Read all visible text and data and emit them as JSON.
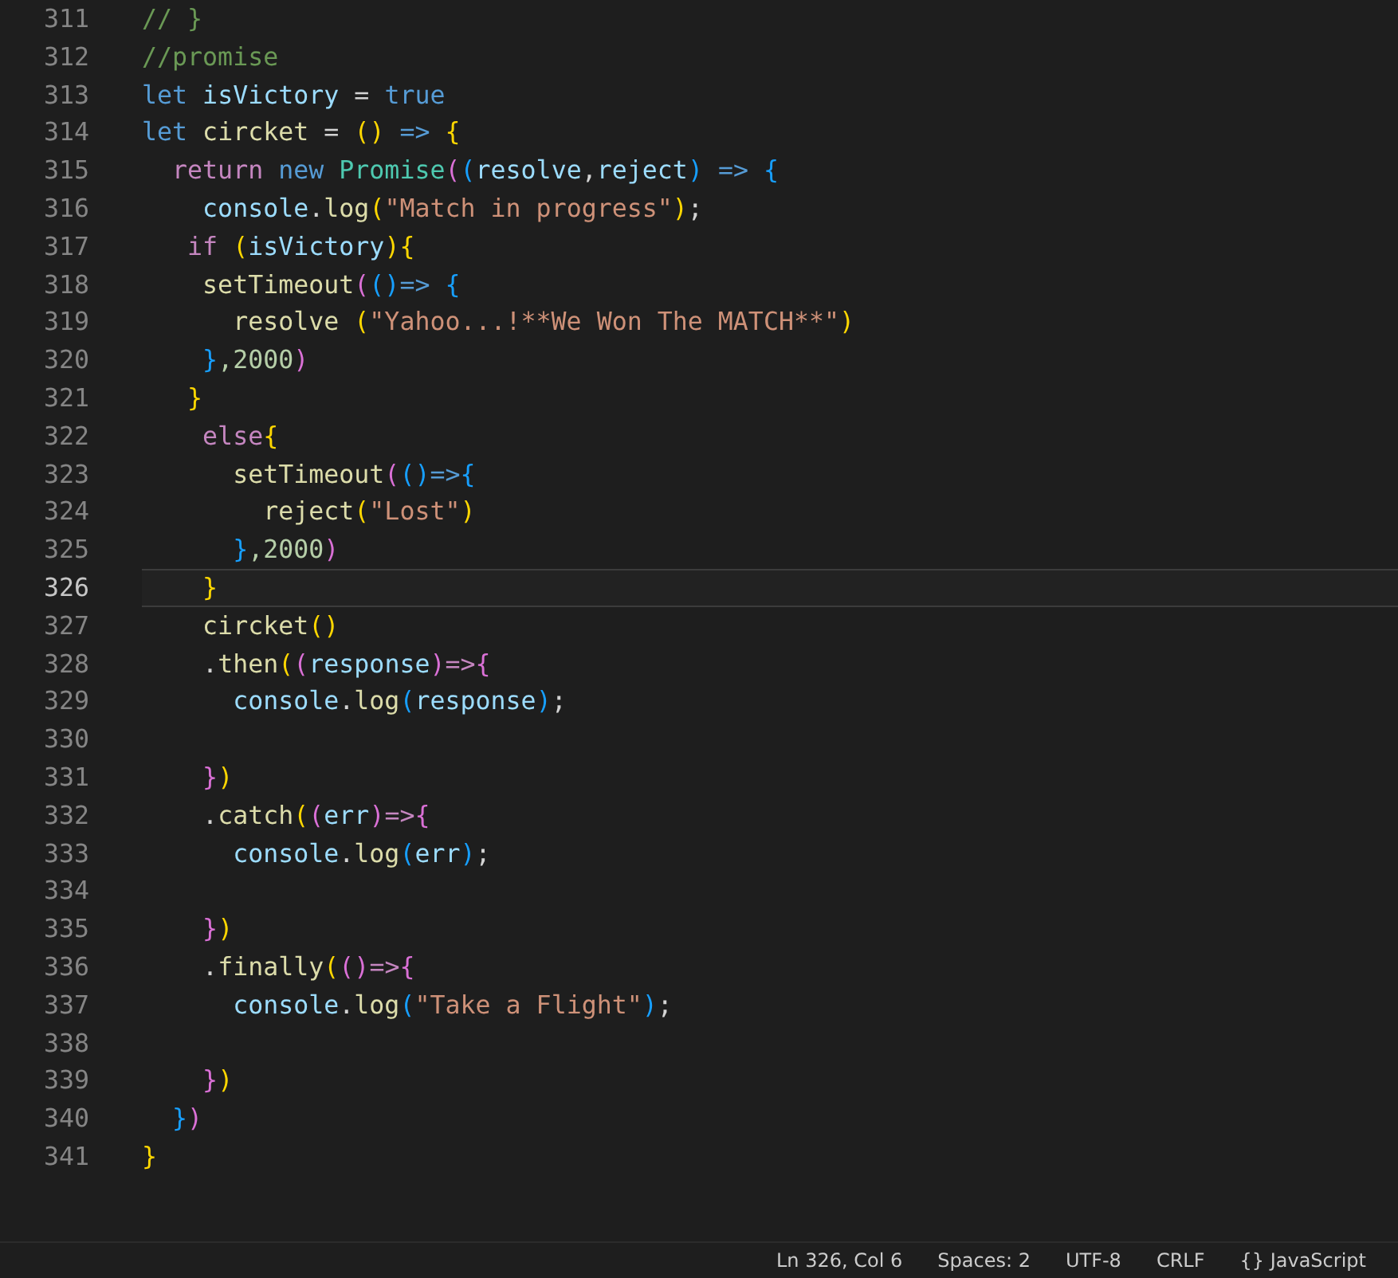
{
  "editor": {
    "lines": [
      {
        "number": "311",
        "current": false,
        "tokens": [
          {
            "kind": "comment",
            "text": "// }"
          }
        ]
      },
      {
        "number": "312",
        "current": false,
        "tokens": [
          {
            "kind": "comment",
            "text": "//promise"
          }
        ]
      },
      {
        "number": "313",
        "current": false,
        "tokens": [
          {
            "kind": "keyword",
            "text": "let"
          },
          {
            "kind": "variable",
            "text": " isVictory"
          },
          {
            "kind": "plain",
            "text": " = "
          },
          {
            "kind": "keyword",
            "text": "true"
          }
        ]
      },
      {
        "number": "314",
        "current": false,
        "tokens": [
          {
            "kind": "keyword",
            "text": "let"
          },
          {
            "kind": "function",
            "text": " circket"
          },
          {
            "kind": "plain",
            "text": " = "
          },
          {
            "kind": "bracket1",
            "text": "()"
          },
          {
            "kind": "keyword",
            "text": " => "
          },
          {
            "kind": "bracket1",
            "text": "{"
          }
        ]
      },
      {
        "number": "315",
        "current": false,
        "tokens": [
          {
            "kind": "control",
            "text": "  return"
          },
          {
            "kind": "keyword",
            "text": " new"
          },
          {
            "kind": "class",
            "text": " Promise"
          },
          {
            "kind": "bracket2",
            "text": "("
          },
          {
            "kind": "bracket3",
            "text": "("
          },
          {
            "kind": "variable",
            "text": "resolve"
          },
          {
            "kind": "plain",
            "text": ","
          },
          {
            "kind": "variable",
            "text": "reject"
          },
          {
            "kind": "bracket3",
            "text": ")"
          },
          {
            "kind": "keyword",
            "text": " => "
          },
          {
            "kind": "bracket3",
            "text": "{"
          }
        ]
      },
      {
        "number": "316",
        "current": false,
        "tokens": [
          {
            "kind": "variable",
            "text": "    console"
          },
          {
            "kind": "plain",
            "text": "."
          },
          {
            "kind": "function",
            "text": "log"
          },
          {
            "kind": "bracket1",
            "text": "("
          },
          {
            "kind": "string",
            "text": "\"Match in progress\""
          },
          {
            "kind": "bracket1",
            "text": ")"
          },
          {
            "kind": "plain",
            "text": ";"
          }
        ]
      },
      {
        "number": "317",
        "current": false,
        "tokens": [
          {
            "kind": "control",
            "text": "   if"
          },
          {
            "kind": "bracket1",
            "text": " ("
          },
          {
            "kind": "variable",
            "text": "isVictory"
          },
          {
            "kind": "bracket1",
            "text": ")"
          },
          {
            "kind": "bracket1",
            "text": "{"
          }
        ]
      },
      {
        "number": "318",
        "current": false,
        "tokens": [
          {
            "kind": "function",
            "text": "    setTimeout"
          },
          {
            "kind": "bracket2",
            "text": "("
          },
          {
            "kind": "bracket3",
            "text": "()"
          },
          {
            "kind": "keyword",
            "text": "=> "
          },
          {
            "kind": "bracket3",
            "text": "{"
          }
        ]
      },
      {
        "number": "319",
        "current": false,
        "tokens": [
          {
            "kind": "function",
            "text": "      resolve"
          },
          {
            "kind": "bracket1",
            "text": " ("
          },
          {
            "kind": "string",
            "text": "\"Yahoo...!**We Won The MATCH**\""
          },
          {
            "kind": "bracket1",
            "text": ")"
          }
        ]
      },
      {
        "number": "320",
        "current": false,
        "tokens": [
          {
            "kind": "bracket3",
            "text": "    }"
          },
          {
            "kind": "number",
            "text": ",2000"
          },
          {
            "kind": "bracket2",
            "text": ")"
          }
        ]
      },
      {
        "number": "321",
        "current": false,
        "tokens": [
          {
            "kind": "bracket1",
            "text": "   }"
          }
        ]
      },
      {
        "number": "322",
        "current": false,
        "tokens": [
          {
            "kind": "control",
            "text": "    else"
          },
          {
            "kind": "bracket1",
            "text": "{"
          }
        ]
      },
      {
        "number": "323",
        "current": false,
        "tokens": [
          {
            "kind": "function",
            "text": "      setTimeout"
          },
          {
            "kind": "bracket2",
            "text": "("
          },
          {
            "kind": "bracket3",
            "text": "()"
          },
          {
            "kind": "keyword",
            "text": "=>"
          },
          {
            "kind": "bracket3",
            "text": "{"
          }
        ]
      },
      {
        "number": "324",
        "current": false,
        "tokens": [
          {
            "kind": "function",
            "text": "        reject"
          },
          {
            "kind": "bracket1",
            "text": "("
          },
          {
            "kind": "string",
            "text": "\"Lost\""
          },
          {
            "kind": "bracket1",
            "text": ")"
          }
        ]
      },
      {
        "number": "325",
        "current": false,
        "tokens": [
          {
            "kind": "bracket3",
            "text": "      }"
          },
          {
            "kind": "number",
            "text": ",2000"
          },
          {
            "kind": "bracket2",
            "text": ")"
          }
        ]
      },
      {
        "number": "326",
        "current": true,
        "tokens": [
          {
            "kind": "bracket1",
            "text": "    }"
          }
        ]
      },
      {
        "number": "327",
        "current": false,
        "tokens": [
          {
            "kind": "function",
            "text": "    circket"
          },
          {
            "kind": "bracket1",
            "text": "()"
          }
        ]
      },
      {
        "number": "328",
        "current": false,
        "tokens": [
          {
            "kind": "plain",
            "text": "    ."
          },
          {
            "kind": "function",
            "text": "then"
          },
          {
            "kind": "bracket1",
            "text": "("
          },
          {
            "kind": "bracket2",
            "text": "("
          },
          {
            "kind": "variable",
            "text": "response"
          },
          {
            "kind": "bracket2",
            "text": ")"
          },
          {
            "kind": "control",
            "text": "=>"
          },
          {
            "kind": "bracket2",
            "text": "{"
          }
        ]
      },
      {
        "number": "329",
        "current": false,
        "tokens": [
          {
            "kind": "variable",
            "text": "      console"
          },
          {
            "kind": "plain",
            "text": "."
          },
          {
            "kind": "function",
            "text": "log"
          },
          {
            "kind": "bracket3",
            "text": "("
          },
          {
            "kind": "variable",
            "text": "response"
          },
          {
            "kind": "bracket3",
            "text": ")"
          },
          {
            "kind": "plain",
            "text": ";"
          }
        ]
      },
      {
        "number": "330",
        "current": false
      },
      {
        "number": "331",
        "current": false,
        "tokens": [
          {
            "kind": "bracket2",
            "text": "    }"
          },
          {
            "kind": "bracket1",
            "text": ")"
          }
        ]
      },
      {
        "number": "332",
        "current": false,
        "tokens": [
          {
            "kind": "plain",
            "text": "    ."
          },
          {
            "kind": "function",
            "text": "catch"
          },
          {
            "kind": "bracket1",
            "text": "("
          },
          {
            "kind": "bracket2",
            "text": "("
          },
          {
            "kind": "variable",
            "text": "err"
          },
          {
            "kind": "bracket2",
            "text": ")"
          },
          {
            "kind": "control",
            "text": "=>"
          },
          {
            "kind": "bracket2",
            "text": "{"
          }
        ]
      },
      {
        "number": "333",
        "current": false,
        "tokens": [
          {
            "kind": "variable",
            "text": "      console"
          },
          {
            "kind": "plain",
            "text": "."
          },
          {
            "kind": "function",
            "text": "log"
          },
          {
            "kind": "bracket3",
            "text": "("
          },
          {
            "kind": "variable",
            "text": "err"
          },
          {
            "kind": "bracket3",
            "text": ")"
          },
          {
            "kind": "plain",
            "text": ";"
          }
        ]
      },
      {
        "number": "334",
        "current": false
      },
      {
        "number": "335",
        "current": false,
        "tokens": [
          {
            "kind": "bracket2",
            "text": "    }"
          },
          {
            "kind": "bracket1",
            "text": ")"
          }
        ]
      },
      {
        "number": "336",
        "current": false,
        "tokens": [
          {
            "kind": "plain",
            "text": "    ."
          },
          {
            "kind": "function",
            "text": "finally"
          },
          {
            "kind": "bracket1",
            "text": "("
          },
          {
            "kind": "bracket2",
            "text": "()"
          },
          {
            "kind": "control",
            "text": "=>"
          },
          {
            "kind": "bracket2",
            "text": "{"
          }
        ]
      },
      {
        "number": "337",
        "current": false,
        "tokens": [
          {
            "kind": "variable",
            "text": "      console"
          },
          {
            "kind": "plain",
            "text": "."
          },
          {
            "kind": "function",
            "text": "log"
          },
          {
            "kind": "bracket3",
            "text": "("
          },
          {
            "kind": "string",
            "text": "\"Take a Flight\""
          },
          {
            "kind": "bracket3",
            "text": ")"
          },
          {
            "kind": "plain",
            "text": ";"
          }
        ]
      },
      {
        "number": "338",
        "current": false
      },
      {
        "number": "339",
        "current": false,
        "tokens": [
          {
            "kind": "bracket2",
            "text": "    }"
          },
          {
            "kind": "bracket1",
            "text": ")"
          }
        ]
      },
      {
        "number": "340",
        "current": false,
        "tokens": [
          {
            "kind": "bracket3",
            "text": "  }"
          },
          {
            "kind": "bracket2",
            "text": ")"
          }
        ]
      },
      {
        "number": "341",
        "current": false,
        "tokens": [
          {
            "kind": "bracket1",
            "text": "}"
          }
        ]
      }
    ]
  },
  "status_bar": [
    "Ln 326, Col 6",
    "Spaces: 2",
    "UTF-8",
    "CRLF",
    "{} JavaScript"
  ]
}
